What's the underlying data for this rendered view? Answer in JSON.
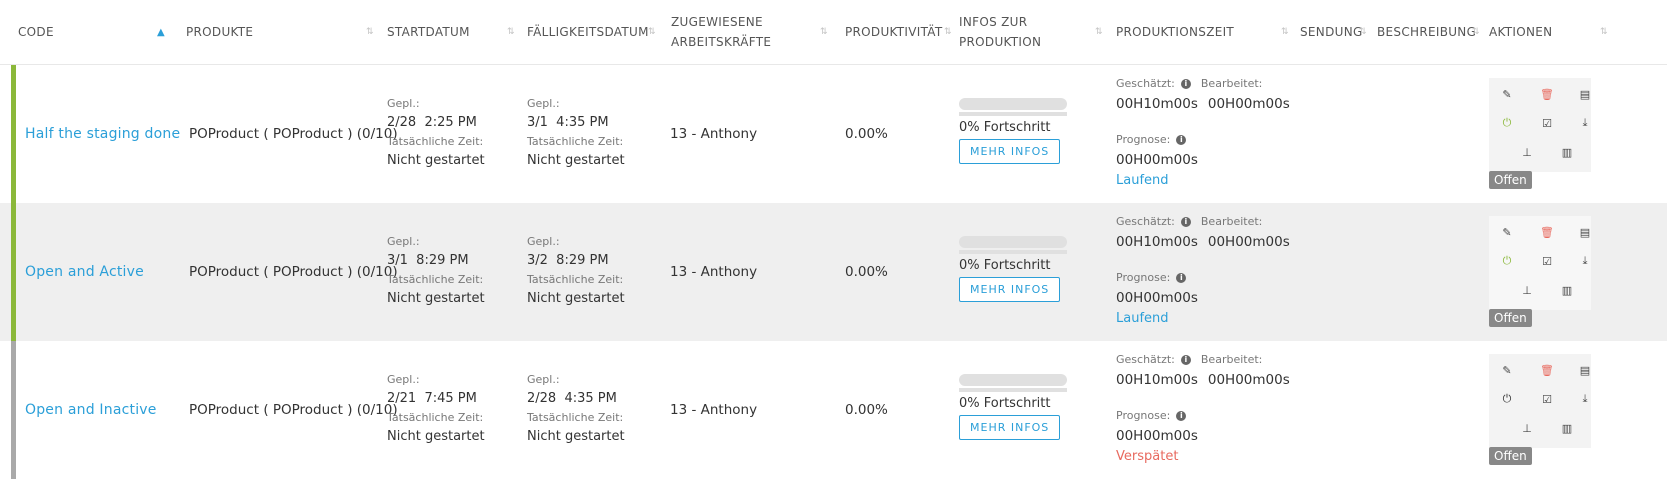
{
  "header": {
    "code": "CODE",
    "products": "PRODUKTE",
    "start": "STARTDATUM",
    "due": "FÄLLIGKEITSDATUM",
    "workers": "ZUGEWIESENE\nARBEITSKRÄFTE",
    "productivity": "PRODUKTIVITÄT",
    "info": "INFOS ZUR\nPRODUKTION",
    "prodtime": "PRODUKTIONSZEIT",
    "shipment": "SENDUNG",
    "description": "BESCHREIBUNG",
    "actions": "AKTIONEN"
  },
  "labels": {
    "planned": "Gepl.:",
    "actual": "Tatsächliche Zeit:",
    "estimated": "Geschätzt:",
    "worked": "Bearbeitet:",
    "forecast": "Prognose:",
    "more_info": "MEHR INFOS"
  },
  "colors": {
    "accent": "#2b9fd8",
    "active_stripe": "#8bb83a",
    "inactive_stripe": "#a9a9a9",
    "late": "#e86a5f",
    "delete_icon": "#e86a5f",
    "power_on": "#8bb83a"
  },
  "rows": [
    {
      "code": "Half the staging done",
      "product": "POProduct ( POProduct ) (0/10)",
      "start_planned": "2/28  2:25 PM",
      "start_actual": "Nicht gestartet",
      "due_planned": "3/1  4:35 PM",
      "due_actual": "Nicht gestartet",
      "worker": "13 - Anthony",
      "productivity": "0.00%",
      "progress": 0,
      "progress_text": "0% Fortschritt",
      "estimated": "00H10m00s",
      "worked": "00H00m00s",
      "forecast": "00H00m00s",
      "status": "Laufend",
      "badge": "Offen",
      "active": true
    },
    {
      "code": "Open and Active",
      "product": "POProduct ( POProduct ) (0/10)",
      "start_planned": "3/1  8:29 PM",
      "start_actual": "Nicht gestartet",
      "due_planned": "3/2  8:29 PM",
      "due_actual": "Nicht gestartet",
      "worker": "13 - Anthony",
      "productivity": "0.00%",
      "progress": 0,
      "progress_text": "0% Fortschritt",
      "estimated": "00H10m00s",
      "worked": "00H00m00s",
      "forecast": "00H00m00s",
      "status": "Laufend",
      "badge": "Offen",
      "active": true
    },
    {
      "code": "Open and Inactive",
      "product": "POProduct ( POProduct ) (0/10)",
      "start_planned": "2/21  7:45 PM",
      "start_actual": "Nicht gestartet",
      "due_planned": "2/28  4:35 PM",
      "due_actual": "Nicht gestartet",
      "worker": "13 - Anthony",
      "productivity": "0.00%",
      "progress": 0,
      "progress_text": "0% Fortschritt",
      "estimated": "00H10m00s",
      "worked": "00H00m00s",
      "forecast": "00H00m00s",
      "status": "Verspätet",
      "badge": "Offen",
      "active": false
    }
  ],
  "action_icons": [
    "edit-icon",
    "delete-icon",
    "document-icon",
    "power-icon",
    "check-icon",
    "download-icon",
    "hierarchy-icon",
    "barcode-icon"
  ]
}
